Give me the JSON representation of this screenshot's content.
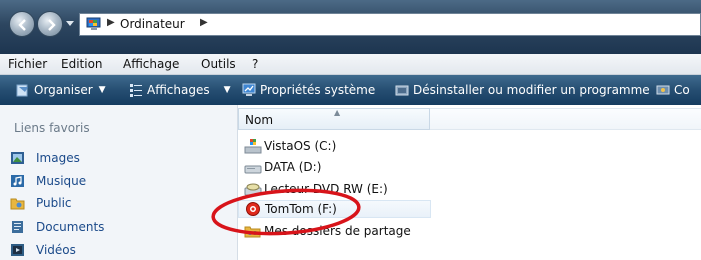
{
  "address_bar": {
    "path": [
      "Ordinateur"
    ]
  },
  "menu": [
    "Fichier",
    "Edition",
    "Affichage",
    "Outils",
    "?"
  ],
  "toolbar": {
    "organise": "Organiser",
    "views": "Affichages",
    "system_props": "Propriétés système",
    "uninstall": "Désinstaller ou modifier un programme",
    "overflow": "Co"
  },
  "nav_pane": {
    "title": "Liens favoris",
    "items": [
      "Images",
      "Musique",
      "Public",
      "Documents",
      "Vidéos"
    ]
  },
  "file_list": {
    "column": "Nom",
    "items": [
      "VistaOS (C:)",
      "DATA (D:)",
      "Lecteur DVD RW (E:)",
      "TomTom (F:)",
      "Mes dossiers de partage"
    ],
    "selected_index": 3
  },
  "colors": {
    "highlight_circle": "#d8141a",
    "toolbar": "#264e72",
    "link": "#1b4a8a"
  }
}
